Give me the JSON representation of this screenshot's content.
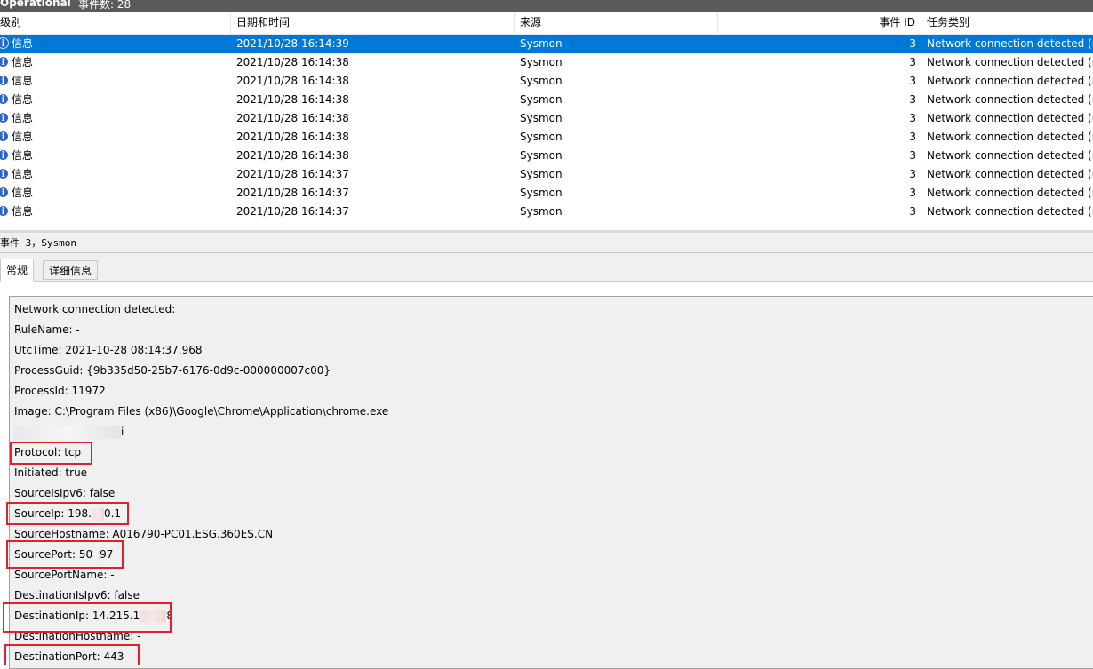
{
  "window": {
    "title_fragment": "Operational",
    "count_fragment": "事件数: 28"
  },
  "columns": {
    "level": "级别",
    "datetime": "日期和时间",
    "source": "来源",
    "event_id": "事件 ID",
    "task_category": "任务类别"
  },
  "rows": [
    {
      "level": "信息",
      "datetime": "2021/10/28 16:14:39",
      "source": "Sysmon",
      "event_id": "3",
      "task": "Network connection detected (ru",
      "selected": true
    },
    {
      "level": "信息",
      "datetime": "2021/10/28 16:14:38",
      "source": "Sysmon",
      "event_id": "3",
      "task": "Network connection detected (ru"
    },
    {
      "level": "信息",
      "datetime": "2021/10/28 16:14:38",
      "source": "Sysmon",
      "event_id": "3",
      "task": "Network connection detected (ru"
    },
    {
      "level": "信息",
      "datetime": "2021/10/28 16:14:38",
      "source": "Sysmon",
      "event_id": "3",
      "task": "Network connection detected (ru"
    },
    {
      "level": "信息",
      "datetime": "2021/10/28 16:14:38",
      "source": "Sysmon",
      "event_id": "3",
      "task": "Network connection detected (ru"
    },
    {
      "level": "信息",
      "datetime": "2021/10/28 16:14:38",
      "source": "Sysmon",
      "event_id": "3",
      "task": "Network connection detected (ru"
    },
    {
      "level": "信息",
      "datetime": "2021/10/28 16:14:38",
      "source": "Sysmon",
      "event_id": "3",
      "task": "Network connection detected (ru"
    },
    {
      "level": "信息",
      "datetime": "2021/10/28 16:14:37",
      "source": "Sysmon",
      "event_id": "3",
      "task": "Network connection detected (ru"
    },
    {
      "level": "信息",
      "datetime": "2021/10/28 16:14:37",
      "source": "Sysmon",
      "event_id": "3",
      "task": "Network connection detected (ru"
    },
    {
      "level": "信息",
      "datetime": "2021/10/28 16:14:37",
      "source": "Sysmon",
      "event_id": "3",
      "task": "Network connection detected (ru"
    }
  ],
  "event_header": "事件 3，Sysmon",
  "tabs": {
    "general": "常规",
    "details": "详细信息"
  },
  "details": {
    "l1": "Network connection detected:",
    "l2": "RuleName: -",
    "l3": "UtcTime: 2021-10-28 08:14:37.968",
    "l4": "ProcessGuid: {9b335d50-25b7-6176-0d9c-000000007c00}",
    "l5": "ProcessId: 11972",
    "l6": "Image: C:\\Program Files (x86)\\Google\\Chrome\\Application\\chrome.exe",
    "l7_suffix": "i",
    "l8": "Protocol: tcp",
    "l9": "Initiated: true",
    "l10": "SourceIsIpv6: false",
    "l11a": "SourceIp: 198.",
    "l11b": "0.1",
    "l12": "SourceHostname: A016790-PC01.ESG.360ES.CN",
    "l13a": "SourcePort: 50",
    "l13b": "97",
    "l14": "SourcePortName: -",
    "l15": "DestinationIsIpv6: false",
    "l16a": "DestinationIp: 14.215.1",
    "l16b": "8",
    "l17": "DestinationHostname: -",
    "l18": "DestinationPort: 443"
  },
  "colors": {
    "selection": "#0078d7",
    "highlight_box": "#e0202a",
    "info_icon": "#2b65c9"
  }
}
